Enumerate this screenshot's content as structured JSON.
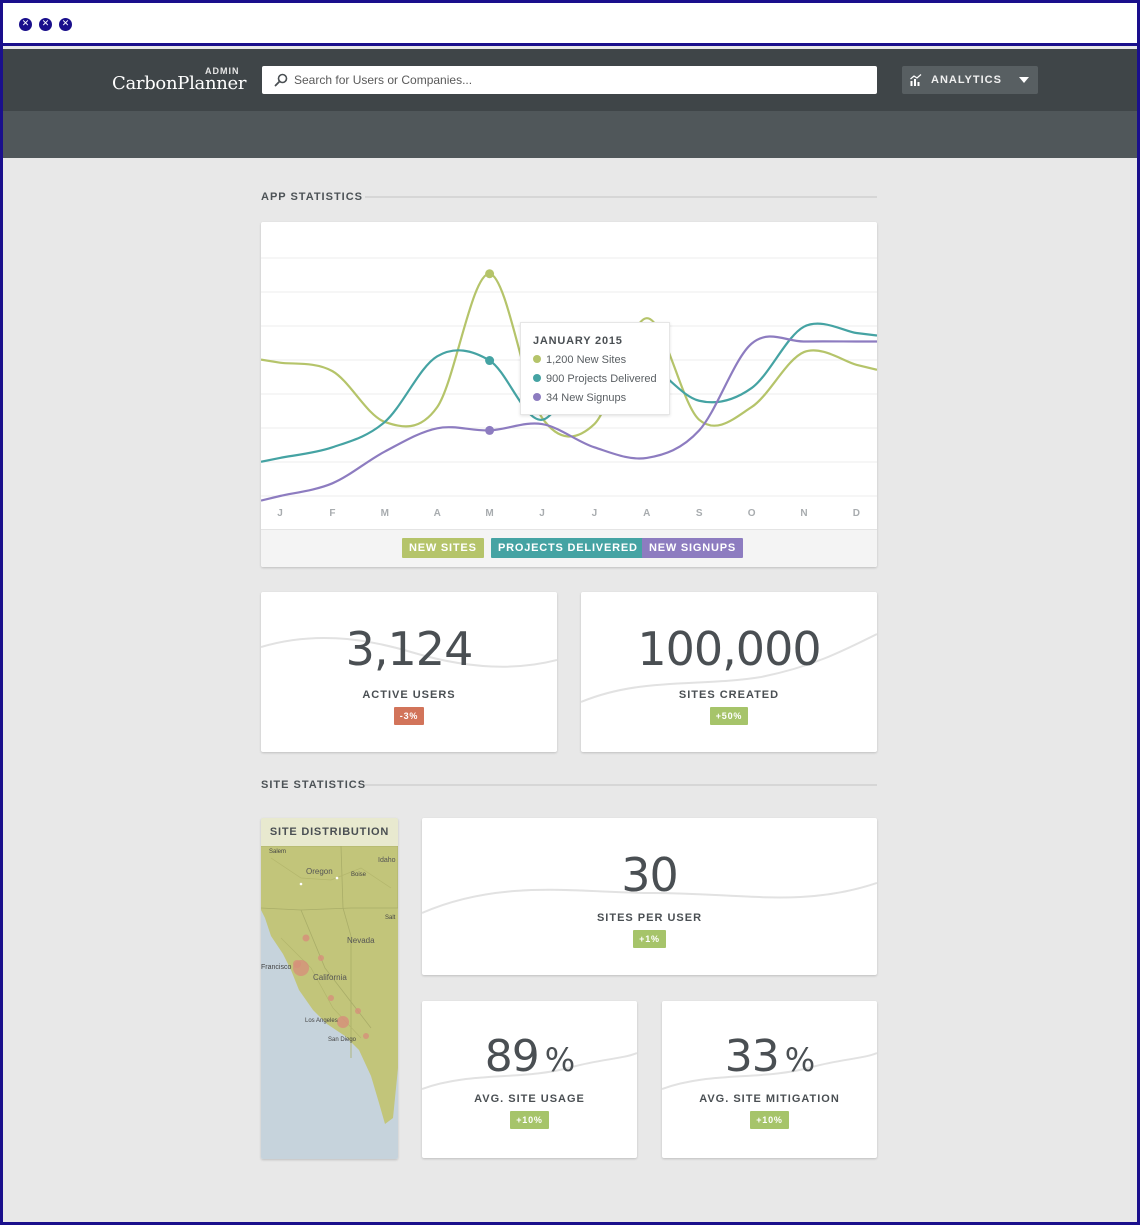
{
  "window": {
    "buttons": [
      "close",
      "close",
      "close"
    ]
  },
  "header": {
    "admin_label": "ADMIN",
    "logo": "CarbonPlanner",
    "search_placeholder": "Search for Users or Companies...",
    "nav_button": "ANALYTICS"
  },
  "sections": {
    "app_statistics": "APP STATISTICS",
    "site_statistics": "SITE STATISTICS"
  },
  "colors": {
    "new_sites": "#b5c46a",
    "projects_delivered": "#45a3a3",
    "new_signups": "#8d7cc0",
    "negative": "#d2745a",
    "positive": "#a6c46a"
  },
  "chart_data": {
    "type": "line",
    "categories": [
      "J",
      "F",
      "M",
      "A",
      "M",
      "J",
      "J",
      "A",
      "S",
      "O",
      "N",
      "D"
    ],
    "series": [
      {
        "name": "NEW SITES",
        "values": [
          6.3,
          5.9,
          3.5,
          4.2,
          10.5,
          3.7,
          3.4,
          8.4,
          3.6,
          4.2,
          6.8,
          6.2
        ]
      },
      {
        "name": "PROJECTS DELIVERED",
        "values": [
          1.8,
          2.3,
          3.5,
          6.6,
          6.4,
          3.6,
          7.0,
          6.3,
          4.5,
          5.1,
          8.0,
          7.7
        ]
      },
      {
        "name": "NEW SIGNUPS",
        "values": [
          0.0,
          0.6,
          2.1,
          3.2,
          3.1,
          3.4,
          2.3,
          1.8,
          3.1,
          7.2,
          7.3,
          7.3
        ]
      }
    ],
    "ylim": [
      0,
      12
    ],
    "grid": true,
    "highlight_index": 4,
    "tooltip": {
      "title": "JANUARY 2015",
      "rows": [
        "1,200 New Sites",
        "900 Projects Delivered",
        "34 New Signups"
      ]
    }
  },
  "stats": {
    "active_users": {
      "value": "3,124",
      "label": "ACTIVE USERS",
      "change": "-3%"
    },
    "sites_created": {
      "value": "100,000",
      "label": "SITES CREATED",
      "change": "+50%"
    },
    "sites_per_user": {
      "value": "30",
      "label": "SITES PER USER",
      "change": "+1%"
    },
    "avg_site_usage": {
      "value": "89",
      "unit": "%",
      "label": "AVG. SITE USAGE",
      "change": "+10%"
    },
    "avg_site_mitigation": {
      "value": "33",
      "unit": "%",
      "label": "AVG. SITE MITIGATION",
      "change": "+10%"
    }
  },
  "map": {
    "title": "SITE DISTRIBUTION",
    "place_labels": [
      "Salem",
      "Oregon",
      "Idaho",
      "Boise",
      "Salt",
      "Nevada",
      "Francisco",
      "California",
      "Los Angeles",
      "San Diego"
    ]
  }
}
